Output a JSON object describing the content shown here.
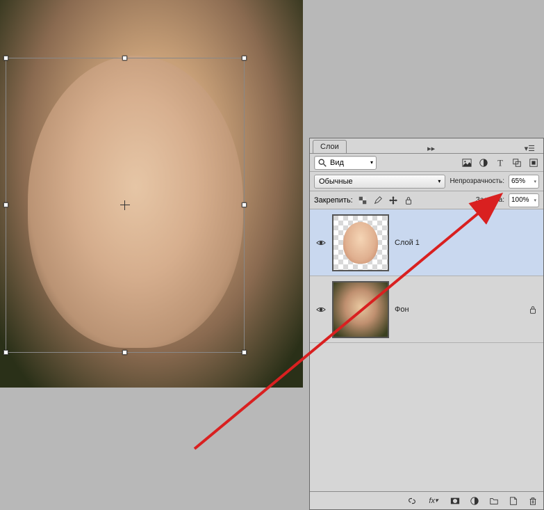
{
  "panel": {
    "title": "Слои"
  },
  "filter": {
    "label": "Вид"
  },
  "blend": {
    "mode": "Обычные",
    "opacity_label": "Непрозрачность:",
    "opacity": "65%"
  },
  "lock": {
    "label": "Закрепить:",
    "fill_label": "Заливка:",
    "fill": "100%"
  },
  "layers": [
    {
      "name": "Слой 1",
      "visible": true,
      "selected": true,
      "locked": false
    },
    {
      "name": "Фон",
      "visible": true,
      "selected": false,
      "locked": true
    }
  ],
  "icons": {
    "search": "search-icon",
    "image": "image-icon",
    "circle": "circle-icon",
    "text": "text-icon",
    "shape": "shape-icon",
    "smart": "smart-icon",
    "link": "link-icon",
    "fx": "fx-icon",
    "mask": "mask-icon",
    "adjustment": "adjustment-icon",
    "group": "group-icon",
    "new": "new-icon",
    "trash": "trash-icon",
    "lock_trans": "lock-transparency-icon",
    "lock_brush": "lock-brush-icon",
    "lock_move": "lock-move-icon",
    "lock_all": "lock-all-icon",
    "eye": "eye-icon"
  }
}
